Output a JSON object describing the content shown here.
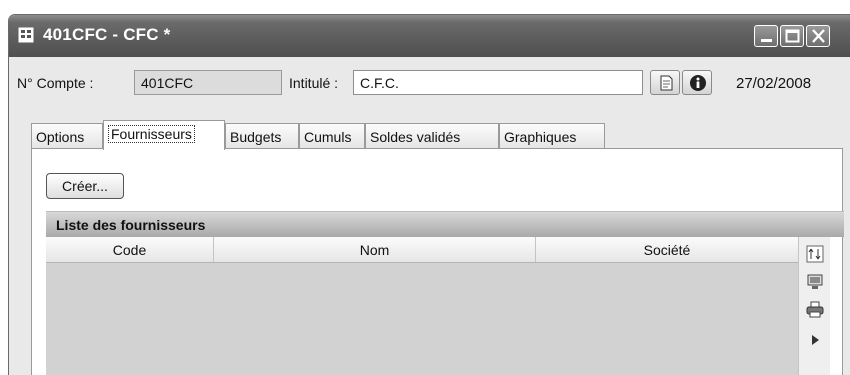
{
  "window": {
    "title": "401CFC - CFC *",
    "icon": "ledger-icon",
    "controls": [
      "minimize-icon",
      "maximize-icon",
      "close-icon"
    ]
  },
  "account": {
    "number_label": "N° Compte :",
    "number_value": "401CFC",
    "title_label": "Intitulé :",
    "title_value": "C.F.C.",
    "date": "27/02/2008",
    "action_icons": [
      "note-icon",
      "info-icon"
    ]
  },
  "tabs": [
    {
      "label": "Options",
      "active": false
    },
    {
      "label": "Fournisseurs",
      "active": true
    },
    {
      "label": "Budgets",
      "active": false
    },
    {
      "label": "Cumuls",
      "active": false
    },
    {
      "label": "Soldes validés",
      "active": false
    },
    {
      "label": "Graphiques",
      "active": false
    }
  ],
  "suppliers": {
    "create_label": "Créer...",
    "list_title": "Liste des fournisseurs",
    "columns": [
      "Code",
      "Nom",
      "Société"
    ],
    "rows": [],
    "side_tools": [
      "column-settings-icon",
      "monitor-icon",
      "printer-icon",
      "arrow-right-icon"
    ]
  }
}
